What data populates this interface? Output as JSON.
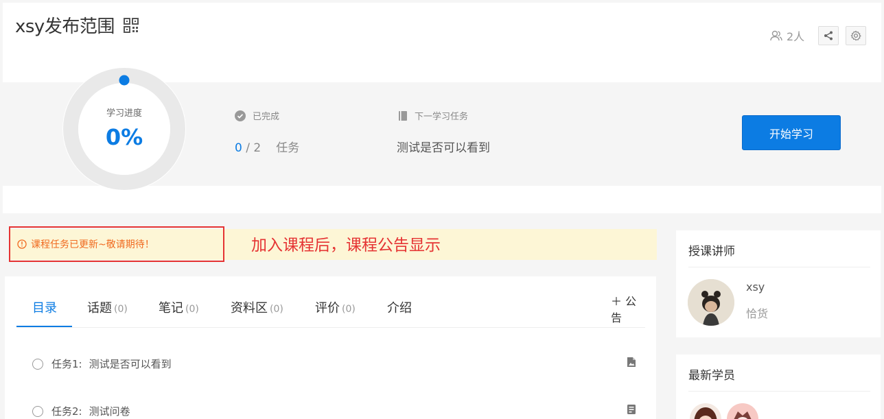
{
  "header": {
    "course_title": "xsy发布范围",
    "member_count": "2人"
  },
  "progress": {
    "label": "学习进度",
    "value": "0%",
    "fraction": 0,
    "completed_label": "已完成",
    "completed_done": "0",
    "completed_sep": " / ",
    "completed_total": "2",
    "completed_unit": "任务",
    "next_label": "下一学习任务",
    "next_task": "测试是否可以看到",
    "start_button": "开始学习"
  },
  "notice": {
    "text": "课程任务已更新~敬请期待！",
    "annotation": "加入课程后，课程公告显示"
  },
  "tabs": [
    {
      "label": "目录",
      "count": ""
    },
    {
      "label": "话题",
      "count": "(0)"
    },
    {
      "label": "笔记",
      "count": "(0)"
    },
    {
      "label": "资料区",
      "count": "(0)"
    },
    {
      "label": "评价",
      "count": "(0)"
    },
    {
      "label": "介绍",
      "count": ""
    }
  ],
  "announce_link": "＋ 公告",
  "tasks": [
    {
      "label": "任务1:",
      "title": "测试是否可以看到",
      "type_icon": "document-image-icon"
    },
    {
      "label": "任务2:",
      "title": "测试问卷",
      "type_icon": "survey-icon"
    }
  ],
  "sidebar": {
    "teacher_title": "授课讲师",
    "teacher_name": "xsy",
    "teacher_role": "恰货",
    "students_title": "最新学员"
  },
  "colors": {
    "accent": "#0c7ce3",
    "notice_bg": "#fdf6d6",
    "notice_text": "#f0691e",
    "annotation_red": "#e53333"
  }
}
